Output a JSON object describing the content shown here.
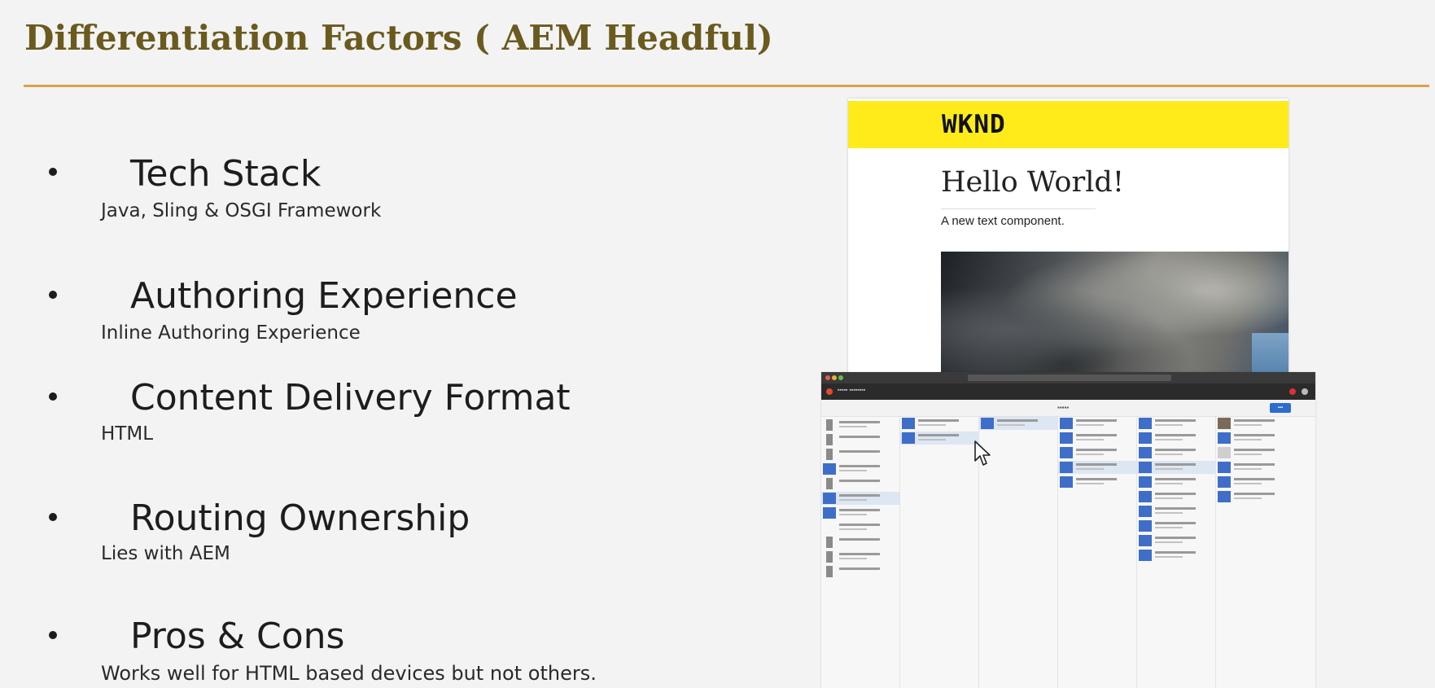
{
  "slide": {
    "title": "Differentiation Factors ( AEM Headful)",
    "accent_color": "#d9a34a",
    "title_color": "#6b5a1e"
  },
  "bullets": [
    {
      "heading": "Tech Stack",
      "detail": "Java, Sling & OSGI Framework"
    },
    {
      "heading": "Authoring Experience",
      "detail": "Inline Authoring Experience"
    },
    {
      "heading": "Content Delivery Format",
      "detail": "HTML"
    },
    {
      "heading": "Routing Ownership",
      "detail": "Lies with AEM"
    },
    {
      "heading": "Pros & Cons",
      "detail": "Works well for HTML based devices but not others."
    }
  ],
  "wknd_preview": {
    "logo": "WKND",
    "heading": "Hello World!",
    "text": "A new text component.",
    "brand_color": "#ffeb1a"
  },
  "aem_screenshot": {
    "header_accent": "#2d6ccf",
    "icon": "aem-sites-column-view",
    "cursor_icon": "mouse-pointer-icon"
  }
}
